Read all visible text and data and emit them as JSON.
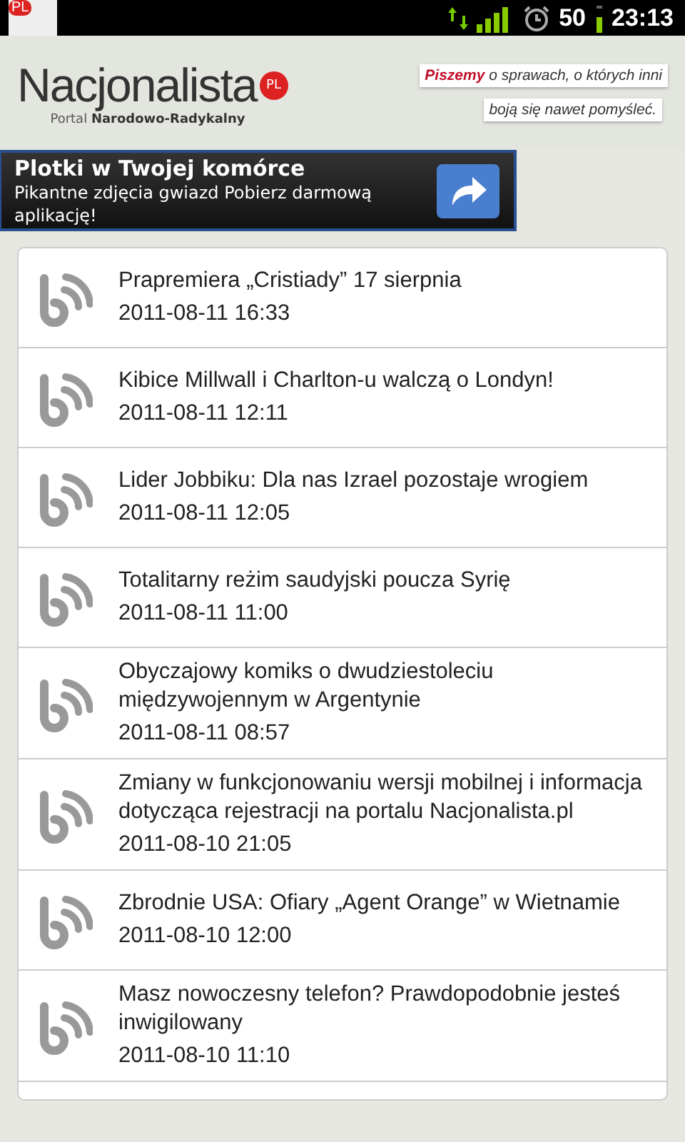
{
  "status_bar": {
    "app_badge": "PL",
    "battery": "50",
    "time": "23:13"
  },
  "header": {
    "logo": "Nacjonalista",
    "logo_badge": "PL",
    "subtitle": "Portal **Narodowo-Radykalny**",
    "tagline": [
      "**Piszemy** o sprawach, o których inni",
      "boją się nawet pomyśleć."
    ]
  },
  "ad": {
    "title": "Plotki w Twojej komórce",
    "text": "Pikantne zdjęcia gwiazd Pobierz darmową aplikację!"
  },
  "articles": [
    {
      "title": "Prapremiera „Cristiady” 17 sierpnia",
      "date": "2011-08-11 16:33"
    },
    {
      "title": "Kibice Millwall i Charlton-u walczą o Londyn!",
      "date": "2011-08-11 12:11"
    },
    {
      "title": "Lider Jobbiku: Dla nas Izrael pozostaje wrogiem",
      "date": "2011-08-11 12:05"
    },
    {
      "title": "Totalitarny reżim saudyjski poucza Syrię",
      "date": "2011-08-11 11:00"
    },
    {
      "title": "Obyczajowy komiks o dwudziestoleciu międzywojennym w Argentynie",
      "date": "2011-08-11 08:57"
    },
    {
      "title": "Zmiany w funkcjonowaniu wersji mobilnej i informacja dotycząca rejestracji na portalu Nacjonalista.pl",
      "date": "2011-08-10 21:05"
    },
    {
      "title": "Zbrodnie USA: Ofiary „Agent Orange” w Wietnamie",
      "date": "2011-08-10 12:00"
    },
    {
      "title": "Masz nowoczesny telefon? Prawdopodobnie jesteś inwigilowany",
      "date": "2011-08-10 11:10"
    }
  ]
}
